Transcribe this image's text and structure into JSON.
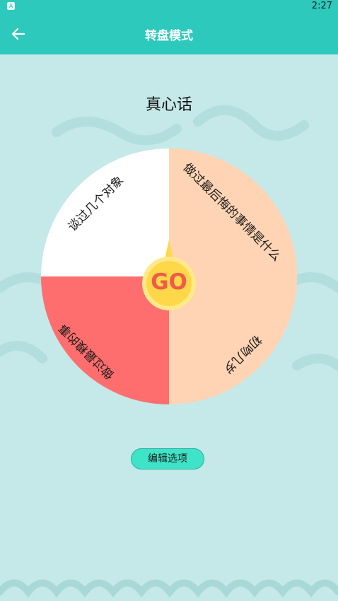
{
  "status_bar": {
    "app_icon": "A",
    "time": "2:27"
  },
  "app_bar": {
    "back_icon": "arrow-left-icon",
    "title": "转盘模式"
  },
  "mode_title": "真心话",
  "wheel": {
    "segments": [
      {
        "label": "谈过几个对象",
        "color": "#ffffff"
      },
      {
        "label": "做过最后悔的事情是什么",
        "color": "#ffd4b4"
      },
      {
        "label": "初吻几岁",
        "color": "#ffd4b4"
      },
      {
        "label": "做过最糗的事",
        "color": "#ff6e6e"
      }
    ],
    "go_label": "GO"
  },
  "edit_button": "编辑选项",
  "colors": {
    "accent": "#2ec9bd",
    "background": "#c5e8e8",
    "go_fill": "#ffd84a",
    "go_text": "#f15a4a",
    "edit_button": "#3fe4c8"
  }
}
